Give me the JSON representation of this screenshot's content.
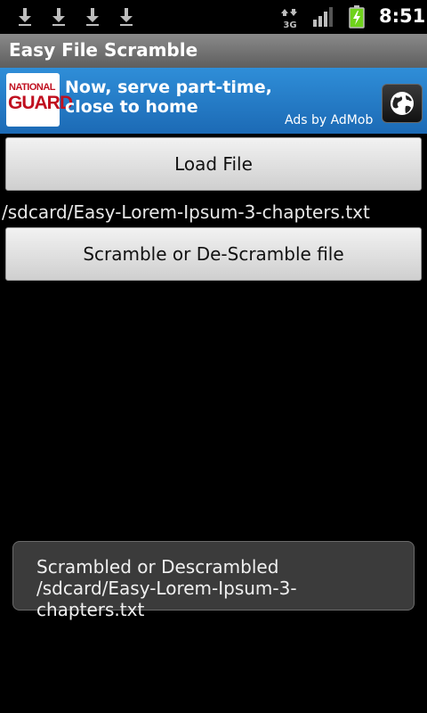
{
  "status_bar": {
    "notifications": [
      "download-icon",
      "download-icon",
      "download-icon",
      "download-icon"
    ],
    "network": "3G",
    "time": "8:51"
  },
  "app": {
    "title": "Easy File Scramble"
  },
  "ad": {
    "logo_line1": "NATIONAL",
    "logo_line2": "GUARD",
    "text": "Now, serve part-time, close to home",
    "attribution": "Ads by AdMob",
    "icon": "globe-icon"
  },
  "main": {
    "load_button": "Load File",
    "file_path": "/sdcard/Easy-Lorem-Ipsum-3-chapters.txt",
    "scramble_button": "Scramble or De-Scramble file"
  },
  "toast": {
    "message": "Scrambled or Descrambled /sdcard/Easy-Lorem-Ipsum-3-chapters.txt"
  },
  "colors": {
    "ad_blue": "#1c6ab5",
    "title_gray": "#6a6a6a",
    "battery_green": "#6fd21b"
  }
}
